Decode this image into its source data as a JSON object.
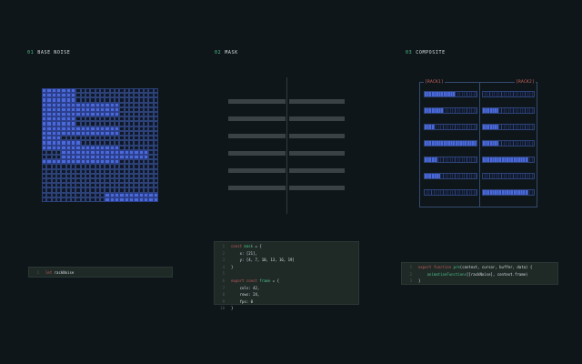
{
  "columns": [
    {
      "num": "01",
      "title": "BASE NOISE"
    },
    {
      "num": "02",
      "title": "MASK"
    },
    {
      "num": "03",
      "title": "COMPOSITE"
    }
  ],
  "composite": {
    "rack_left": "[RACK1]",
    "rack_right": "[RACK2]",
    "rows_left": [
      0.6,
      0.35,
      0.2,
      1.0,
      0.25,
      0.3,
      0.0
    ],
    "rows_right": [
      0.0,
      0.3,
      0.3,
      0.3,
      0.9,
      0.0,
      0.9
    ]
  },
  "code1": {
    "lines": [
      {
        "n": "1",
        "tokens": [
          {
            "t": "let ",
            "c": "kw"
          },
          {
            "t": "rackNoise",
            "c": "nm"
          }
        ]
      }
    ]
  },
  "code2": {
    "lines": [
      {
        "n": "1",
        "tokens": [
          {
            "t": "const ",
            "c": "kw"
          },
          {
            "t": "mask",
            "c": "fn"
          },
          {
            "t": " = {",
            "c": "nm"
          }
        ]
      },
      {
        "n": "2",
        "tokens": [
          {
            "t": "    x: [21],",
            "c": "nm"
          }
        ]
      },
      {
        "n": "3",
        "tokens": [
          {
            "t": "    y: [4, 7, 10, 13, 16, 19]",
            "c": "nm"
          }
        ]
      },
      {
        "n": "4",
        "tokens": [
          {
            "t": "}",
            "c": "nm"
          }
        ]
      },
      {
        "n": "5",
        "tokens": []
      },
      {
        "n": "6",
        "tokens": [
          {
            "t": "export ",
            "c": "kw"
          },
          {
            "t": "const ",
            "c": "kw"
          },
          {
            "t": "frame",
            "c": "fn"
          },
          {
            "t": " = {",
            "c": "nm"
          }
        ]
      },
      {
        "n": "7",
        "tokens": [
          {
            "t": "    cols: 42,",
            "c": "nm"
          }
        ]
      },
      {
        "n": "8",
        "tokens": [
          {
            "t": "    rows: 24,",
            "c": "nm"
          }
        ]
      },
      {
        "n": "9",
        "tokens": [
          {
            "t": "    fps: 0",
            "c": "nm"
          }
        ]
      },
      {
        "n": "10",
        "tokens": [
          {
            "t": "}",
            "c": "nm"
          }
        ]
      }
    ]
  },
  "code3": {
    "lines": [
      {
        "n": "1",
        "tokens": [
          {
            "t": "export ",
            "c": "kw"
          },
          {
            "t": "function ",
            "c": "kw"
          },
          {
            "t": "pre",
            "c": "fn"
          },
          {
            "t": "(context, cursor, buffer, data) {",
            "c": "nm"
          }
        ]
      },
      {
        "n": "2",
        "tokens": [
          {
            "t": "    ",
            "c": "nm"
          },
          {
            "t": "animationFunctions",
            "c": "fn"
          },
          {
            "t": "[[rackNoise], context.frame)",
            "c": "nm"
          }
        ]
      },
      {
        "n": "3",
        "tokens": [
          {
            "t": "}",
            "c": "nm"
          }
        ]
      }
    ]
  }
}
